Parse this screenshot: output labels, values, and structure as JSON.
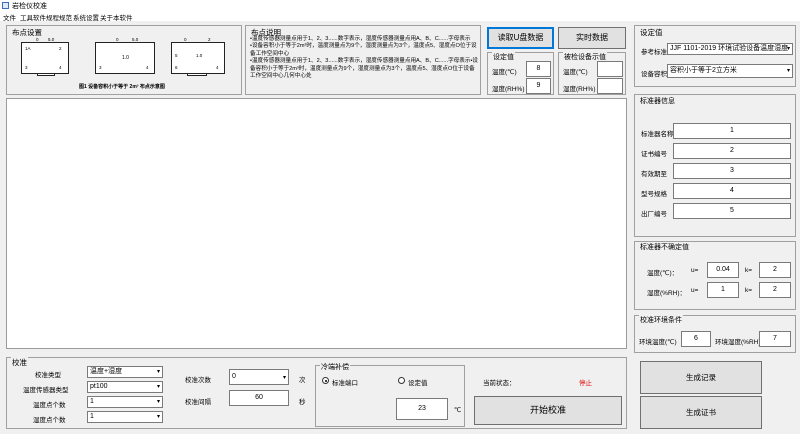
{
  "window": {
    "title": "岩检仪校准"
  },
  "menu": [
    "文件",
    "工具软件",
    "规程规范",
    "系统设置",
    "关于本软件"
  ],
  "layout_group": {
    "title": "布点设置",
    "diagram": {
      "box1_top": [
        "0",
        "5.0"
      ],
      "box1_mid": [
        "1A",
        "2"
      ],
      "box1_bot": [
        "3",
        "4"
      ],
      "box2_top": [
        "0",
        "5.0"
      ],
      "box2_mid": "1.0",
      "box2_bot": [
        "3",
        "4"
      ],
      "box3_top": [
        "0",
        "2"
      ],
      "box3_mid": [
        "5",
        "1.0"
      ],
      "box3_bot": [
        "6",
        "4"
      ],
      "caption": "图1 设备容积小于等于 2m³ 布点示意图"
    }
  },
  "notes": {
    "title": "布点说明",
    "lines": [
      "•温度传感器测量点用于1、2、3......数字表示，湿度传感器测量点用A、B、C......字母表示",
      "•设备容积小于等于2m³时，温度测量点为9个，湿度测量点为3个，温度点5、湿度点O位于设备工作空间中心",
      "•温度传感器测量点用于1、2、3......数字表示，湿度传感器测量点用A、B、C......字母表示•设备容积小于等于2m³时，温度测量点为9个，湿度测量点为3个，温度点5、湿度点O位于设备工作空间中心几何中心处"
    ]
  },
  "buttons": {
    "read_u": "读取U盘数据",
    "realtime": "实时数据",
    "start": "开始校准",
    "gen_record": "生成记录",
    "gen_cert": "生成证书"
  },
  "setpoint": {
    "title": "设定值",
    "temp_label": "温度(℃)",
    "temp_value": "8",
    "hum_label": "湿度(RH%)",
    "hum_value": "9"
  },
  "device_display": {
    "title": "被检设备示值",
    "temp_label": "温度(℃)",
    "temp_value": "",
    "hum_label": "湿度(RH%)",
    "hum_value": ""
  },
  "settings": {
    "title": "设定值",
    "ref_label": "参考标准",
    "ref_value": "JJF 1101-2019 环境试验设备温度湿度",
    "volume_label": "设备容积",
    "volume_value": "容积小于等于2立方米"
  },
  "std_info": {
    "title": "标准器信息",
    "rows": [
      {
        "label": "标准器名称",
        "value": "1"
      },
      {
        "label": "证书编号",
        "value": "2"
      },
      {
        "label": "有效期至",
        "value": "3"
      },
      {
        "label": "型号规格",
        "value": "4"
      },
      {
        "label": "出厂编号",
        "value": "5"
      }
    ]
  },
  "uncertainty": {
    "title": "标准器不确定值",
    "temp_label": "温度(℃)：",
    "temp_u_label": "u=",
    "temp_u": "0.04",
    "temp_k_label": "k=",
    "temp_k": "2",
    "hum_label": "湿度(%RH)：",
    "hum_u_label": "u=",
    "hum_u": "1",
    "hum_k_label": "k=",
    "hum_k": "2"
  },
  "env": {
    "title": "校准环境条件",
    "temp_label": "环境温度(℃)",
    "temp_value": "6",
    "hum_label": "环境湿度(%RH)",
    "hum_value": "7"
  },
  "calib": {
    "title": "校准",
    "type_label": "校准类型",
    "type_value": "温度+湿度",
    "sensor_label": "温度传感器类型",
    "sensor_value": "pt100",
    "temp_points_label": "温度点个数",
    "temp_points_value": "1",
    "hum_points_label": "湿度点个数",
    "hum_points_value": "1",
    "count_label": "校准次数",
    "count_value": "0",
    "count_unit": "次",
    "interval_label": "校准间隔",
    "interval_value": "60",
    "interval_unit": "秒"
  },
  "cold_comp": {
    "title": "冷端补偿",
    "opt1": "标准端口",
    "opt2": "设定值",
    "value": "23",
    "unit": "℃"
  },
  "status": {
    "label": "当前状态：",
    "value": "停止",
    "value_color": "#e00000"
  }
}
